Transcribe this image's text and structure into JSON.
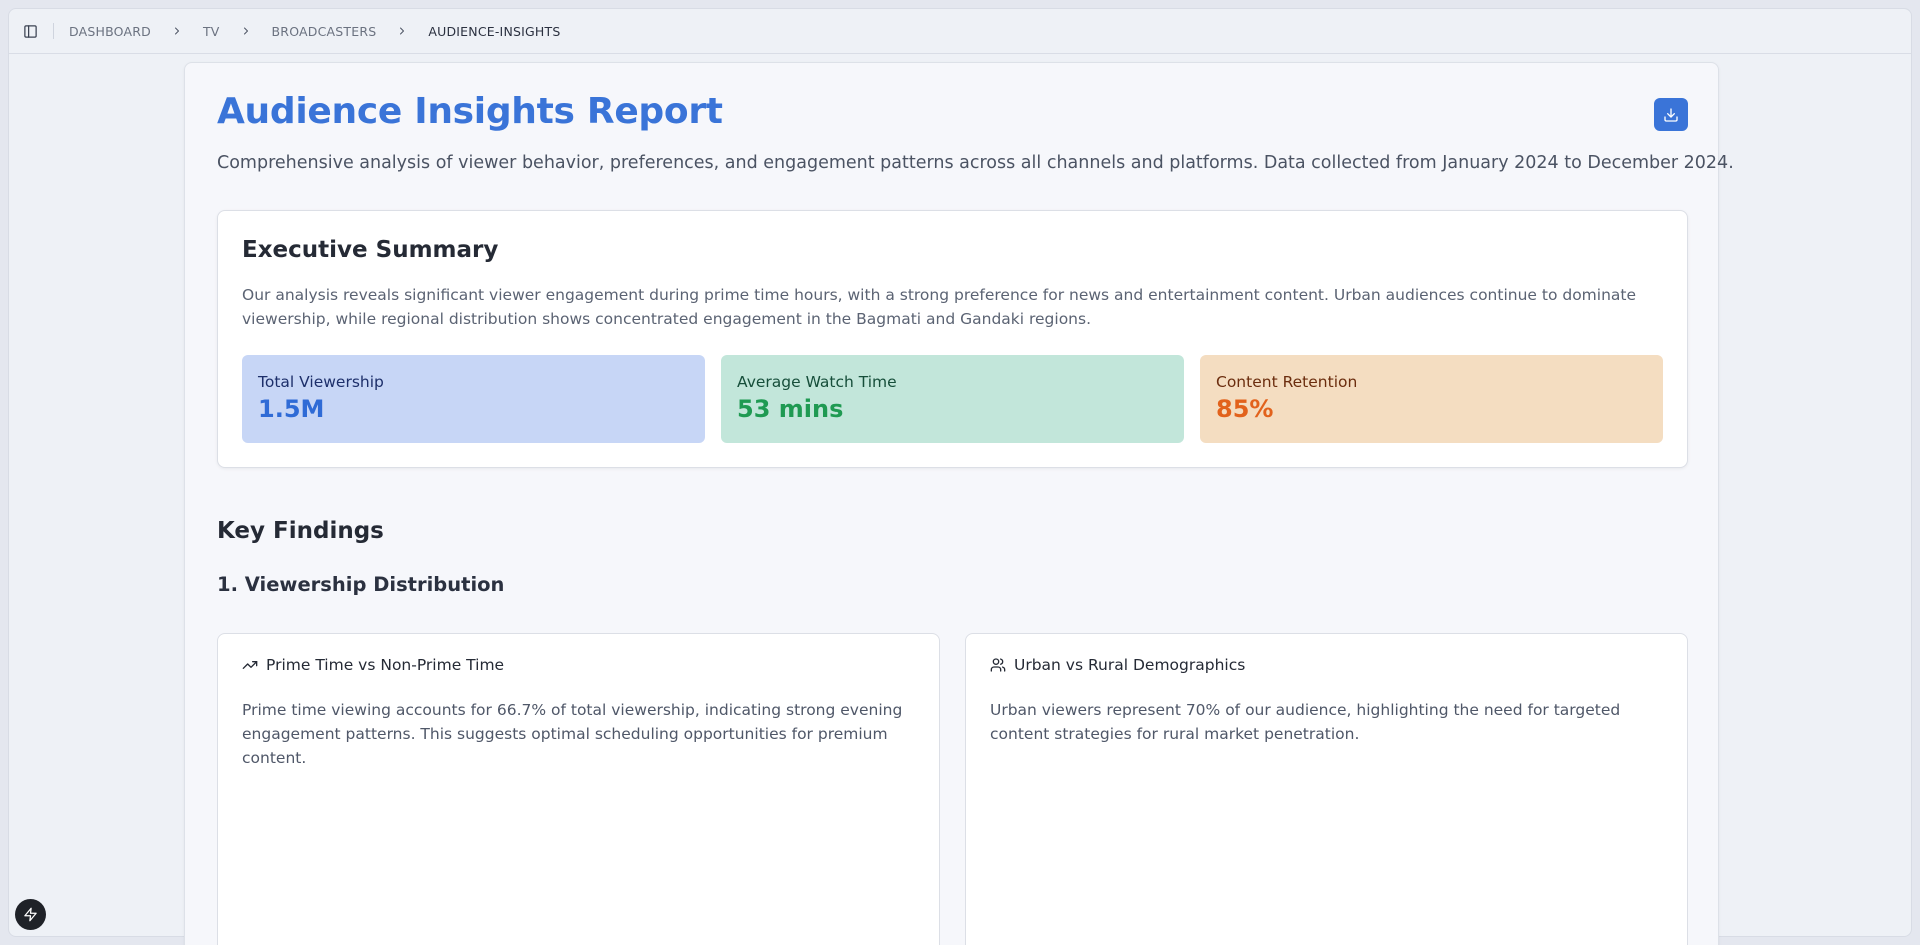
{
  "breadcrumb": {
    "items": [
      "DASHBOARD",
      "TV",
      "BROADCASTERS"
    ],
    "current": "AUDIENCE-INSIGHTS"
  },
  "report": {
    "title": "Audience Insights Report",
    "description": "Comprehensive analysis of viewer behavior, preferences, and engagement patterns across all channels and platforms. Data collected from January 2024 to December 2024."
  },
  "summary": {
    "title": "Executive Summary",
    "text": "Our analysis reveals significant viewer engagement during prime time hours, with a strong preference for news and entertainment content. Urban audiences continue to dominate viewership, while regional distribution shows concentrated engagement in the Bagmati and Gandaki regions.",
    "metrics": [
      {
        "label": "Total Viewership",
        "value": "1.5M",
        "color": "#2f6bd6"
      },
      {
        "label": "Average Watch Time",
        "value": "53 mins",
        "color": "#1f9a52"
      },
      {
        "label": "Content Retention",
        "value": "85%",
        "color": "#e2621c"
      }
    ]
  },
  "findings": {
    "title": "Key Findings",
    "section1": "1. Viewership Distribution",
    "cards": [
      {
        "icon": "trending-up-icon",
        "title": "Prime Time vs Non-Prime Time",
        "text": "Prime time viewing accounts for 66.7% of total viewership, indicating strong evening engagement patterns. This suggests optimal scheduling opportunities for premium content."
      },
      {
        "icon": "users-icon",
        "title": "Urban vs Rural Demographics",
        "text": "Urban viewers represent 70% of our audience, highlighting the need for targeted content strategies for rural market penetration."
      }
    ]
  },
  "accent": "#3a74d8"
}
